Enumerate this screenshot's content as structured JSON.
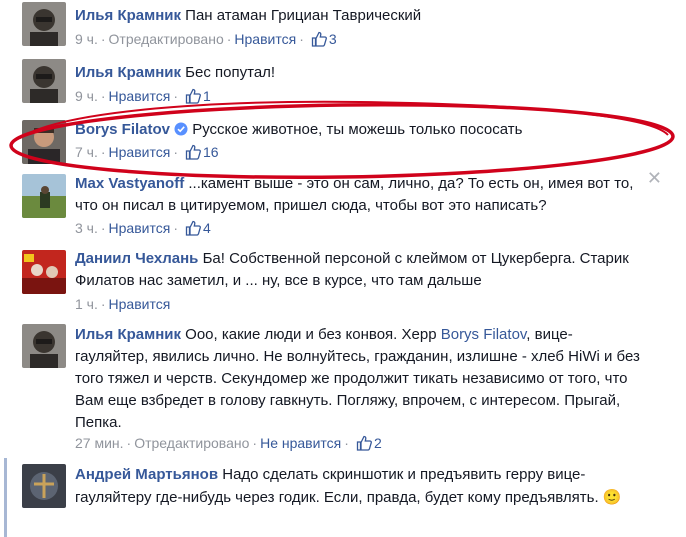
{
  "comments": [
    {
      "author": "Илья Крамник",
      "text": "Пан атаман Грициан Таврический",
      "time": "9 ч.",
      "edited": "Отредактировано",
      "like_action": "Нравится",
      "likes": "3"
    },
    {
      "author": "Илья Крамник",
      "text": "Бес попутал!",
      "time": "9 ч.",
      "like_action": "Нравится",
      "likes": "1"
    },
    {
      "author": "Borys Filatov",
      "text": "Русское животное, ты можешь только пососать",
      "time": "7 ч.",
      "like_action": "Нравится",
      "likes": "16",
      "verified": true
    },
    {
      "author": "Max Vastyanoff",
      "text": "...камент выше - это он сам, лично, да? То есть он, имея вот то, что он писал в цитируемом, пришел сюда, чтобы вот это написать?",
      "time": "3 ч.",
      "like_action": "Нравится",
      "likes": "4",
      "close_glyph": "✕"
    },
    {
      "author": "Даниил Чехлань",
      "text": "Ба! Собственной персоной с клеймом от Цукерберга. Старик Филатов нас заметил, и ... ну, все в курсе, что там дальше",
      "time": "1 ч.",
      "like_action": "Нравится"
    },
    {
      "author": "Илья Крамник",
      "text_before": "Ооо, какие люди и без конвоя. Херр",
      "mention": "Borys Filatov",
      "text_after": ", вице-гауляйтер, явились лично. Не волнуйтесь, гражданин, излишне - хлеб HiWi и без того тяжел и черств. Секундомер же продолжит тикать независимо от того, что Вам еще взбредет в голову гавкнуть. Погляжу, впрочем, с интересом. Прыгай, Пепка.",
      "time": "27 мин.",
      "edited": "Отредактировано",
      "like_action": "Не нравится",
      "likes": "2"
    },
    {
      "author": "Андрей Мартьянов",
      "text": "Надо сделать скриншотик и предъявить герру вице-гауляйтеру где-нибудь через годик. Если, правда, будет кому предъявлять.",
      "emoji": "🙂"
    }
  ],
  "colors": {
    "link": "#365899",
    "meta": "#90949c",
    "highlight_ellipse": "#d0021b"
  }
}
